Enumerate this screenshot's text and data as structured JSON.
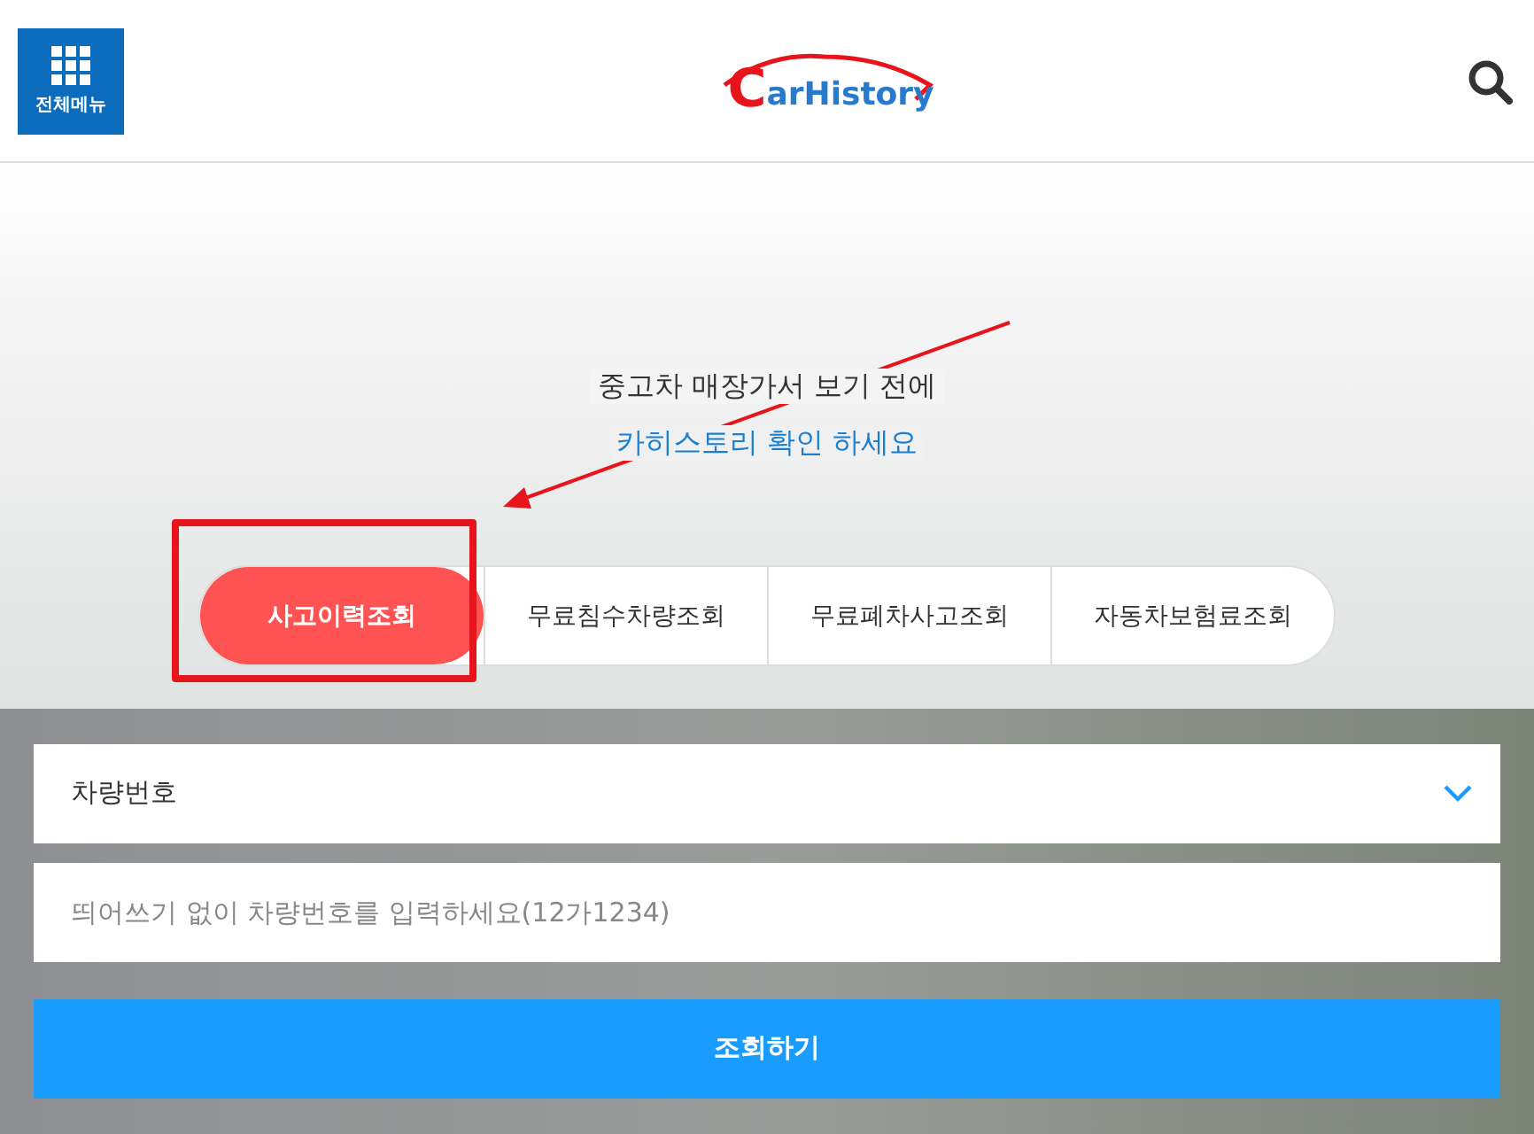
{
  "header": {
    "menu_label": "전체메뉴",
    "logo": {
      "initial": "C",
      "rest": "arHistory"
    }
  },
  "hero": {
    "line_1": "중고차 매장가서 보기 전에",
    "line_2": "카히스토리 확인 하세요"
  },
  "tabs": [
    {
      "label": "사고이력조회",
      "selected": true
    },
    {
      "label": "무료침수차량조회",
      "selected": false
    },
    {
      "label": "무료폐차사고조회",
      "selected": false
    },
    {
      "label": "자동차보험료조회",
      "selected": false
    }
  ],
  "form": {
    "select_value": "차량번호",
    "input_placeholder": "띄어쓰기 없이 차량번호를 입력하세요(12가1234)",
    "submit": "조회하기"
  }
}
